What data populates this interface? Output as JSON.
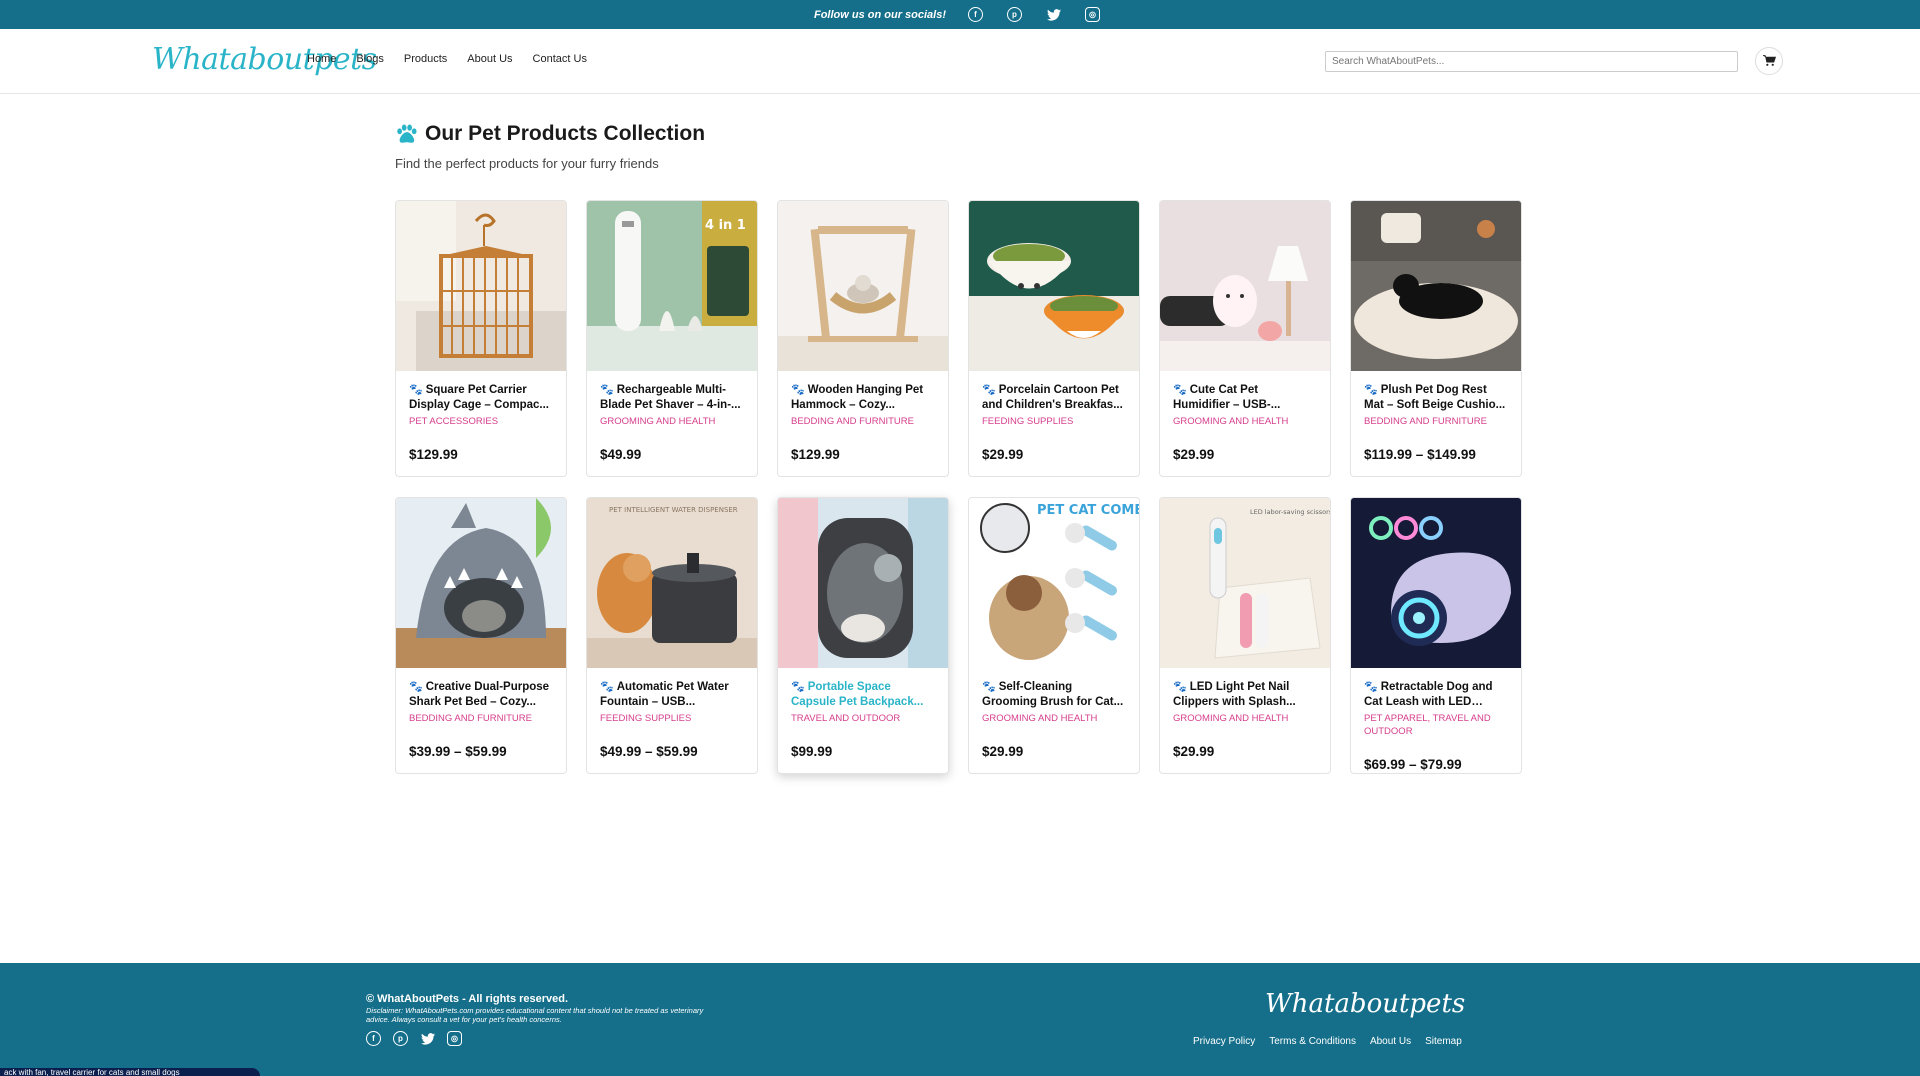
{
  "topbar": {
    "follow_text": "Follow us on our socials!",
    "icons": [
      "facebook-icon",
      "pinterest-icon",
      "twitter-icon",
      "instagram-icon"
    ]
  },
  "header": {
    "logo": "Whataboutpets",
    "nav": [
      "Home",
      "Blogs",
      "Products",
      "About Us",
      "Contact Us"
    ],
    "search_placeholder": "Search WhatAboutPets...",
    "cart_icon": "cart-icon"
  },
  "main": {
    "title": "Our Pet Products Collection",
    "subtitle": "Find the perfect products for your furry friends",
    "products": [
      {
        "title": "Square Pet Carrier Display Cage – Compac...",
        "category": "PET ACCESSORIES",
        "price": "$129.99"
      },
      {
        "title": "Rechargeable Multi-Blade Pet Shaver – 4-in-...",
        "category": "GROOMING AND HEALTH",
        "price": "$49.99"
      },
      {
        "title": "Wooden Hanging Pet Hammock – Cozy...",
        "category": "BEDDING AND FURNITURE",
        "price": "$129.99"
      },
      {
        "title": "Porcelain Cartoon Pet and Children's Breakfas...",
        "category": "FEEDING SUPPLIES",
        "price": "$29.99"
      },
      {
        "title": "Cute Cat Pet Humidifier – USB-...",
        "category": "GROOMING AND HEALTH",
        "price": "$29.99"
      },
      {
        "title": "Plush Pet Dog Rest Mat – Soft Beige Cushio...",
        "category": "BEDDING AND FURNITURE",
        "price": "$119.99 – $149.99"
      },
      {
        "title": "Creative Dual-Purpose Shark Pet Bed – Cozy...",
        "category": "BEDDING AND FURNITURE",
        "price": "$39.99 – $59.99"
      },
      {
        "title": "Automatic Pet Water Fountain – USB...",
        "category": "FEEDING SUPPLIES",
        "price": "$49.99 – $59.99"
      },
      {
        "title": "Portable Space Capsule Pet Backpack...",
        "category": "TRAVEL AND OUTDOOR",
        "price": "$99.99"
      },
      {
        "title": "Self-Cleaning Grooming Brush for Cat...",
        "category": "GROOMING AND HEALTH",
        "price": "$29.99"
      },
      {
        "title": "LED Light Pet Nail Clippers with Splash...",
        "category": "GROOMING AND HEALTH",
        "price": "$29.99"
      },
      {
        "title": "Retractable Dog and Cat Leash with LED Ligh...",
        "category": "PET APPAREL, TRAVEL AND OUTDOOR",
        "price": "$69.99 – $79.99"
      }
    ],
    "image_text": {
      "shaver": "4 in 1",
      "fountain": "PET INTELLIGENT WATER DISPENSER",
      "comb": "PET CAT COMB",
      "clipper": "LED labor-saving scissors"
    }
  },
  "footer": {
    "copyright": "© WhatAboutPets - All rights reserved.",
    "disclaimer": "Disclaimer: WhatAboutPets.com provides educational content that should not be treated as veterinary advice. Always consult a vet for your pet's health concerns.",
    "logo": "Whataboutpets",
    "links": [
      "Privacy Policy",
      "Terms & Conditions",
      "About Us",
      "Sitemap"
    ]
  },
  "ticker": "ack with fan, travel carrier for cats and small dogs",
  "colors": {
    "brand": "#156f8a",
    "accent": "#2ab4c8",
    "category": "#d63e8c"
  }
}
